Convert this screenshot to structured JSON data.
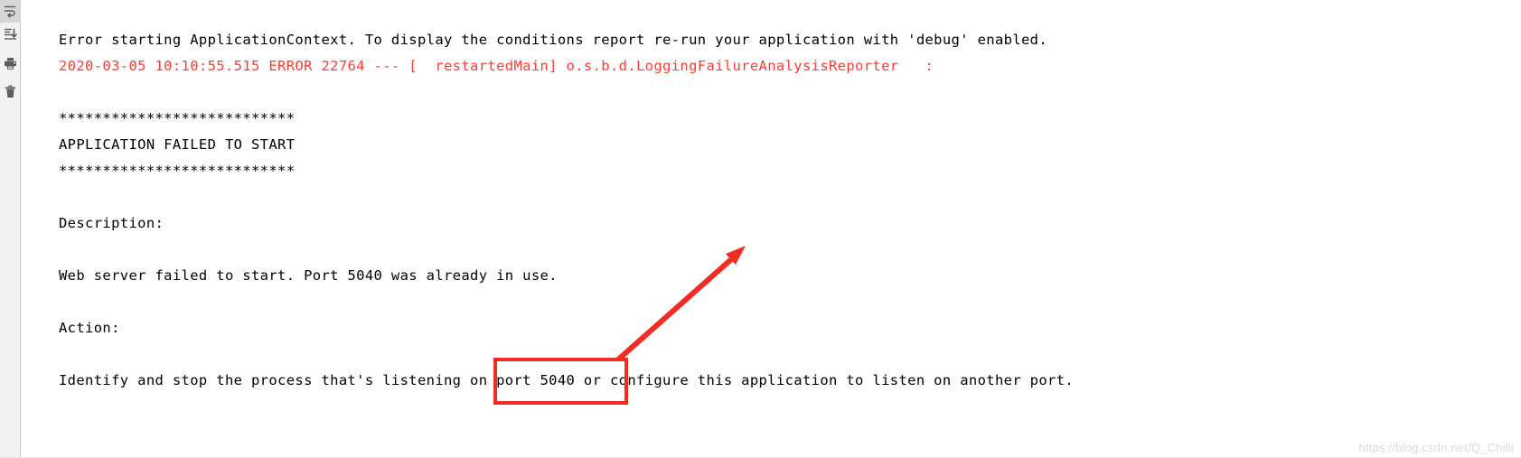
{
  "toolbar": {
    "items": [
      {
        "name": "soft-wrap-icon",
        "label": "Soft-Wrap",
        "active": true
      },
      {
        "name": "scroll-to-end-icon",
        "label": "Scroll to End",
        "active": false
      },
      {
        "name": "print-icon",
        "label": "Print",
        "active": false
      },
      {
        "name": "trash-icon",
        "label": "Clear All",
        "active": false
      }
    ]
  },
  "console": {
    "lines": [
      {
        "text": "Error starting ApplicationContext. To display the conditions report re-run your application with 'debug' enabled.",
        "level": "info"
      },
      {
        "text": "2020-03-05 10:10:55.515 ERROR 22764 --- [  restartedMain] o.s.b.d.LoggingFailureAnalysisReporter   :",
        "level": "error"
      },
      {
        "text": "",
        "level": "blank"
      },
      {
        "text": "***************************",
        "level": "info"
      },
      {
        "text": "APPLICATION FAILED TO START",
        "level": "info"
      },
      {
        "text": "***************************",
        "level": "info"
      },
      {
        "text": "",
        "level": "blank"
      },
      {
        "text": "Description:",
        "level": "info"
      },
      {
        "text": "",
        "level": "blank"
      },
      {
        "text": "Web server failed to start. Port 5040 was already in use.",
        "level": "info"
      },
      {
        "text": "",
        "level": "blank"
      },
      {
        "text": "Action:",
        "level": "info"
      },
      {
        "text": "",
        "level": "blank"
      },
      {
        "text": "Identify and stop the process that's listening on port 5040 or configure this application to listen on another port.",
        "level": "info"
      }
    ]
  },
  "annotation": {
    "highlight_text": "port 5040 or",
    "arrow_color": "#f22c21",
    "box_color": "#f22c21"
  },
  "watermark": {
    "text": "https://blog.csdn.net/Q_Chilli"
  }
}
